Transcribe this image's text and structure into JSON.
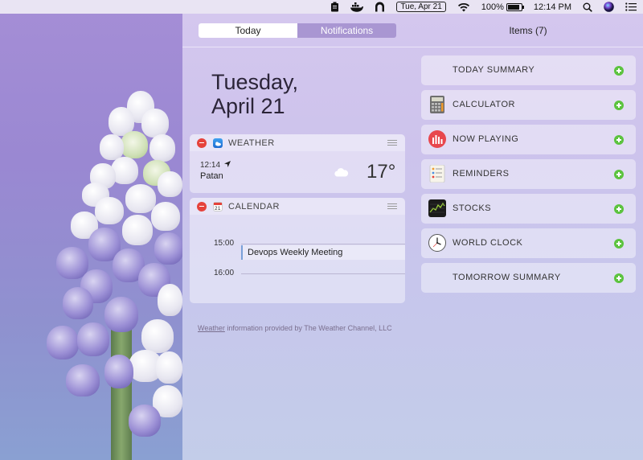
{
  "menubar": {
    "date": "Tue, Apr 21",
    "battery": "100%",
    "time": "12:14 PM",
    "icons": [
      "clipboard-icon",
      "docker-icon",
      "arch-icon",
      "wifi-icon",
      "battery-icon",
      "search-icon",
      "siri-icon",
      "notification-center-icon"
    ]
  },
  "tabs": [
    {
      "label": "Today",
      "active": true
    },
    {
      "label": "Notifications",
      "active": false
    }
  ],
  "items_count": "Items (7)",
  "date": {
    "weekday": "Tuesday,",
    "day": "April 21"
  },
  "weather": {
    "header": "WEATHER",
    "time": "12:14",
    "city": "Patan",
    "temp": "17°",
    "condition_icon": "cloud-icon"
  },
  "calendar": {
    "header": "CALENDAR",
    "slots": [
      "15:00",
      "16:00"
    ],
    "event": "Devops Weekly Meeting"
  },
  "credit": {
    "link": "Weather",
    "text": " information provided by The Weather Channel, LLC"
  },
  "available_items": [
    {
      "label": "TODAY SUMMARY",
      "icon": ""
    },
    {
      "label": "CALCULATOR",
      "icon": "calculator-icon"
    },
    {
      "label": "NOW PLAYING",
      "icon": "now-playing-icon"
    },
    {
      "label": "REMINDERS",
      "icon": "reminders-icon"
    },
    {
      "label": "STOCKS",
      "icon": "stocks-icon"
    },
    {
      "label": "WORLD CLOCK",
      "icon": "world-clock-icon"
    },
    {
      "label": "TOMORROW SUMMARY",
      "icon": ""
    }
  ],
  "colors": {
    "remove": "#e5423b",
    "add": "#5cc33f"
  }
}
